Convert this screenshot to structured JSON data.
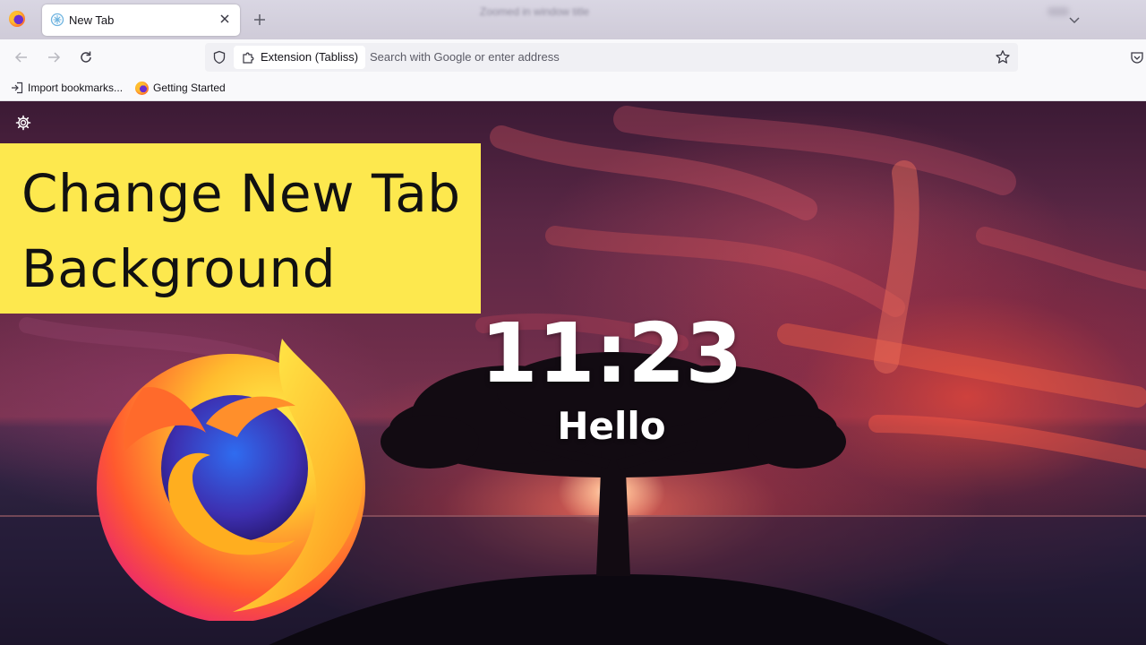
{
  "browser": {
    "tab": {
      "title": "New Tab"
    },
    "blurred_window_title": "Zoomed in window title",
    "urlbar": {
      "identity_chip": "Extension (Tabliss)",
      "placeholder": "Search with Google or enter address"
    },
    "bookmarks": [
      {
        "label": "Import bookmarks...",
        "icon": "import-icon"
      },
      {
        "label": "Getting Started",
        "icon": "firefox-icon"
      }
    ]
  },
  "newtab": {
    "overlay_title_line1": "Change New Tab",
    "overlay_title_line2": "Background",
    "clock": "11:23",
    "greeting": "Hello"
  },
  "colors": {
    "overlay_yellow": "#fde84e",
    "chrome_bg": "#f9f9fb",
    "tabbar_bg": "#d9d6e3"
  }
}
